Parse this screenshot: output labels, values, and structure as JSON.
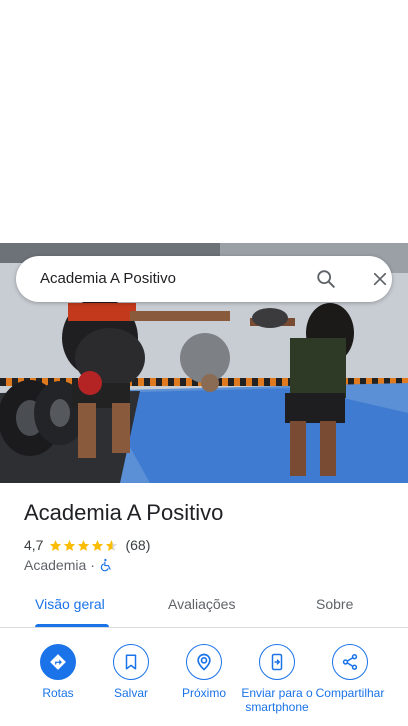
{
  "search": {
    "query": "Academia A Positivo",
    "search_icon": "search-icon",
    "close_icon": "close-icon"
  },
  "place": {
    "name": "Academia A Positivo",
    "rating": "4,7",
    "rating_stars": 4.7,
    "review_count": "(68)",
    "category": "Academia",
    "separator": "·",
    "accessibility_icon": "wheelchair-icon"
  },
  "tabs": [
    {
      "label": "Visão geral",
      "active": true
    },
    {
      "label": "Avaliações",
      "active": false
    },
    {
      "label": "Sobre",
      "active": false
    }
  ],
  "actions": [
    {
      "label": "Rotas",
      "icon": "directions-icon"
    },
    {
      "label": "Salvar",
      "icon": "bookmark-icon"
    },
    {
      "label": "Próximo",
      "icon": "nearby-icon"
    },
    {
      "label": "Enviar para o smartphone",
      "icon": "send-to-phone-icon"
    },
    {
      "label": "Compartilhar",
      "icon": "share-icon"
    }
  ],
  "colors": {
    "accent": "#1a73e8",
    "star": "#fbbc04",
    "text": "#202124",
    "secondary_text": "#5f6368"
  }
}
